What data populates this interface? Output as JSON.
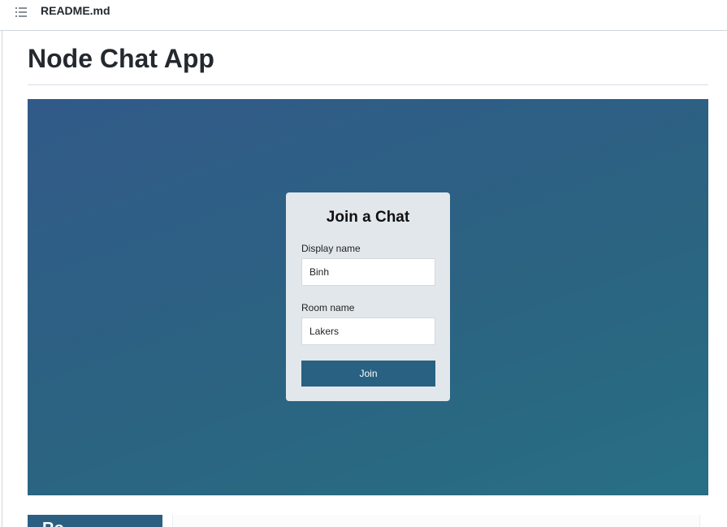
{
  "readme": {
    "icon": "list-unordered-icon",
    "file_name": "README.md",
    "title": "Node Chat App"
  },
  "join_card": {
    "title": "Join a Chat",
    "display_name_label": "Display name",
    "display_name_value": "Binh",
    "room_name_label": "Room name",
    "room_name_value": "Lakers",
    "join_label": "Join"
  },
  "next_section": {
    "partial_heading": "Ro..."
  },
  "colors": {
    "gradient_start": "#315a89",
    "gradient_end": "#286f84",
    "card_bg": "#e2e7ec",
    "button_bg": "#286182"
  }
}
